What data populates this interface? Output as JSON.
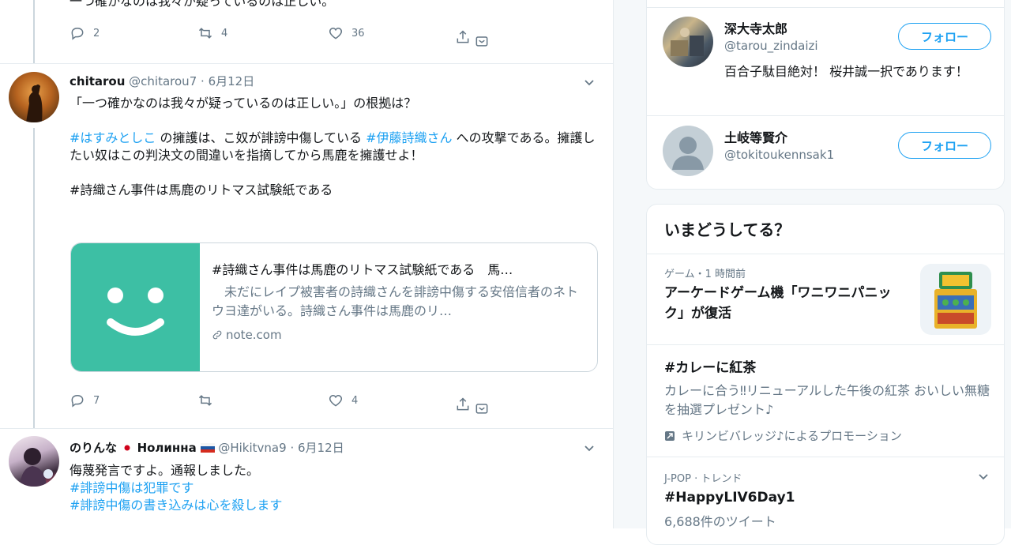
{
  "tweet_prev": {
    "cut_text": "一つ確かなのは我々が疑っているのは正しい。",
    "replies": "2",
    "retweets": "4",
    "likes": "36"
  },
  "tweet1": {
    "name": "chitarou",
    "handle": "@chitarou7",
    "sep": "·",
    "date": "6月12日",
    "line1": "「一つ確かなのは我々が疑っているのは正しい。」の根拠は？",
    "tag1": "#はすみとしこ",
    "text_a": " の擁護は、こ奴が誹謗中傷している ",
    "tag2": "#伊藤詩織さん",
    "text_b": " への攻撃である。擁護したい奴はこの判決文の間違いを指摘してから馬鹿を擁護せよ！",
    "line3": "#詩織さん事件は馬鹿のリトマス試験紙である",
    "card": {
      "title": "#詩織さん事件は馬鹿のリトマス試験紙である　馬…",
      "desc": "　未だにレイプ被害者の詩織さんを誹謗中傷する安倍信者のネトウヨ達がいる。詩織さん事件は馬鹿のリ…",
      "domain": "note.com"
    },
    "replies": "7",
    "retweets": "",
    "likes": "4"
  },
  "tweet2": {
    "name": "のりんな",
    "name2": "Нолинна",
    "handle": "@Hikitvna9",
    "sep": "·",
    "date": "6月12日",
    "line1": "侮蔑発言ですよ。通報しました。",
    "tag1": "#誹謗中傷は犯罪です",
    "tag2": "#誹謗中傷の書き込みは心を殺します"
  },
  "who_to_follow": [
    {
      "name": "深大寺太郎",
      "handle": "@tarou_zindaizi",
      "bio": "百合子駄目絶対！ 桜井誠一択であります！",
      "button": "フォロー"
    },
    {
      "name": "土岐等賢介",
      "handle": "@tokitoukennsak1",
      "bio": "",
      "button": "フォロー"
    }
  ],
  "trends": {
    "header": "いまどうしてる？",
    "items": [
      {
        "meta": "ゲーム・1 時間前",
        "title": "アーケードゲーム機「ワニワニパニック」が復活"
      },
      {
        "title": "#カレーに紅茶",
        "desc": "カレーに合う‼リニューアルした午後の紅茶 おいしい無糖を抽選プレゼント♪",
        "promo": "キリンビバレッジ♪によるプロモーション"
      },
      {
        "meta": "J-POP · トレンド",
        "title": "#HappyLIV6Day1",
        "count": "6,688件のツイート"
      }
    ]
  },
  "colors": {
    "accent": "#1da1f2",
    "muted": "#657786",
    "card_image": "#3dbfa4"
  }
}
